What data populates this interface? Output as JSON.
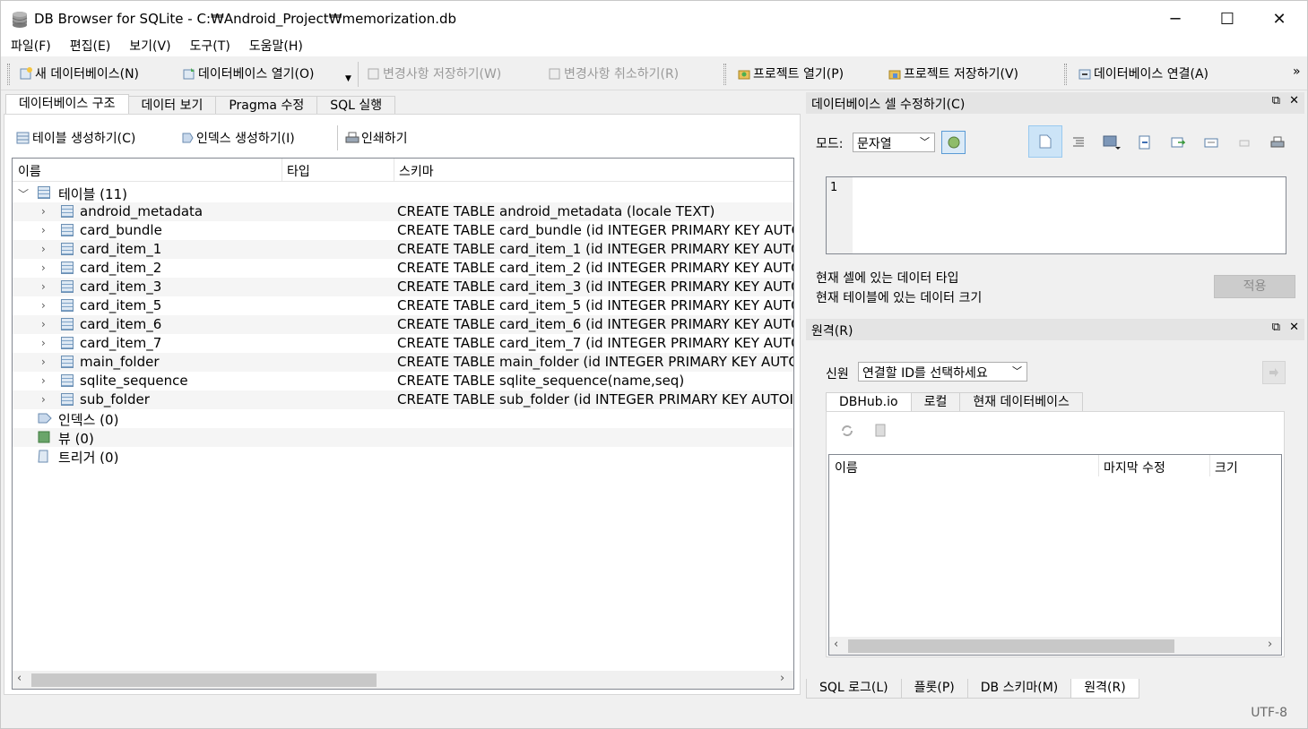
{
  "window": {
    "title": "DB Browser for SQLite - C:₩Android_Project₩memorization.db",
    "minimize": "─",
    "maximize": "☐",
    "close": "✕"
  },
  "menu": [
    "파일(F)",
    "편집(E)",
    "보기(V)",
    "도구(T)",
    "도움말(H)"
  ],
  "toolbar": {
    "new_db": "새 데이터베이스(N)",
    "open_db": "데이터베이스 열기(O)",
    "write_changes": "변경사항 저장하기(W)",
    "revert_changes": "변경사항 취소하기(R)",
    "open_project": "프로젝트 열기(P)",
    "save_project": "프로젝트 저장하기(V)",
    "attach_db": "데이터베이스 연결(A)",
    "overflow": "»"
  },
  "main_tabs": [
    "데이터베이스 구조",
    "데이터 보기",
    "Pragma 수정",
    "SQL 실행"
  ],
  "structure_toolbar": {
    "create_table": "테이블 생성하기(C)",
    "create_index": "인덱스 생성하기(I)",
    "print": "인쇄하기"
  },
  "tree": {
    "headers": [
      "이름",
      "타입",
      "스키마"
    ],
    "tables_label": "테이블 (11)",
    "tables": [
      {
        "name": "android_metadata",
        "schema": "CREATE TABLE android_metadata (locale TEXT)"
      },
      {
        "name": "card_bundle",
        "schema": "CREATE TABLE card_bundle (id INTEGER PRIMARY KEY AUTO"
      },
      {
        "name": "card_item_1",
        "schema": "CREATE TABLE card_item_1 (id INTEGER PRIMARY KEY AUTO"
      },
      {
        "name": "card_item_2",
        "schema": "CREATE TABLE card_item_2 (id INTEGER PRIMARY KEY AUTO"
      },
      {
        "name": "card_item_3",
        "schema": "CREATE TABLE card_item_3 (id INTEGER PRIMARY KEY AUTO"
      },
      {
        "name": "card_item_5",
        "schema": "CREATE TABLE card_item_5 (id INTEGER PRIMARY KEY AUTO"
      },
      {
        "name": "card_item_6",
        "schema": "CREATE TABLE card_item_6 (id INTEGER PRIMARY KEY AUTO"
      },
      {
        "name": "card_item_7",
        "schema": "CREATE TABLE card_item_7 (id INTEGER PRIMARY KEY AUTO"
      },
      {
        "name": "main_folder",
        "schema": "CREATE TABLE main_folder (id INTEGER PRIMARY KEY AUTO"
      },
      {
        "name": "sqlite_sequence",
        "schema": "CREATE TABLE sqlite_sequence(name,seq)"
      },
      {
        "name": "sub_folder",
        "schema": "CREATE TABLE sub_folder (id INTEGER PRIMARY KEY AUTOI"
      }
    ],
    "indexes_label": "인덱스 (0)",
    "views_label": "뷰 (0)",
    "triggers_label": "트리거 (0)"
  },
  "edit_cell": {
    "title": "데이터베이스 셀 수정하기(C)",
    "mode_label": "모드:",
    "mode_value": "문자열",
    "line_number": "1",
    "data_type_text": "현재 셀에 있는 데이터 타입",
    "data_size_text": "현재 테이블에 있는 데이터 크기",
    "apply": "적용"
  },
  "remote": {
    "title": "원격(R)",
    "identity_label": "신원",
    "identity_value": "연결할 ID를 선택하세요",
    "tabs": [
      "DBHub.io",
      "로컬",
      "현재 데이터베이스"
    ],
    "columns": [
      "이름",
      "마지막 수정",
      "크기"
    ]
  },
  "bottom_tabs": [
    "SQL 로그(L)",
    "플롯(P)",
    "DB 스키마(M)",
    "원격(R)"
  ],
  "status": {
    "encoding": "UTF-8"
  }
}
